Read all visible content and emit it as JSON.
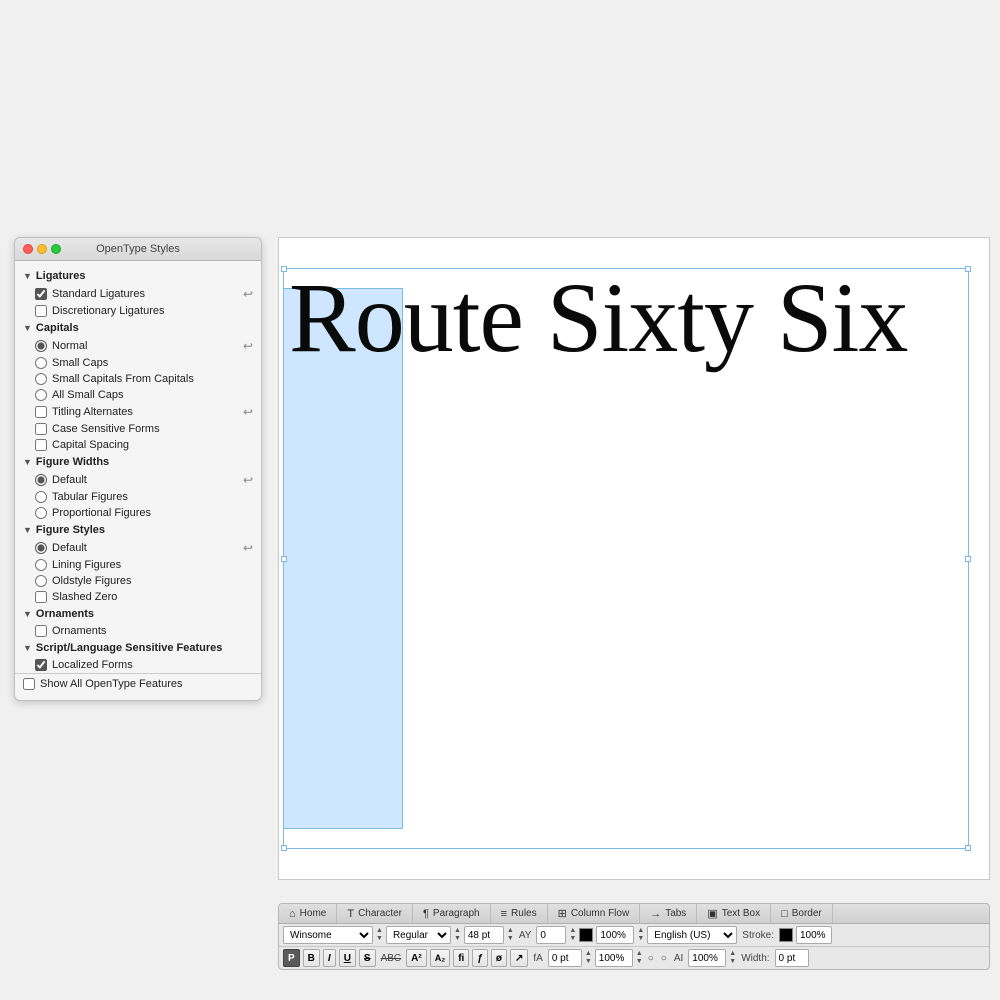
{
  "panel": {
    "title": "OpenType Styles",
    "sections": {
      "ligatures": {
        "label": "Ligatures",
        "items": [
          {
            "id": "standard-ligatures",
            "type": "checkbox",
            "label": "Standard Ligatures",
            "checked": true,
            "icon": true
          },
          {
            "id": "discretionary-ligatures",
            "type": "checkbox",
            "label": "Discretionary Ligatures",
            "checked": false,
            "icon": false
          }
        ]
      },
      "capitals": {
        "label": "Capitals",
        "items": [
          {
            "id": "normal",
            "type": "radio",
            "label": "Normal",
            "checked": true,
            "icon": true
          },
          {
            "id": "small-caps",
            "type": "radio",
            "label": "Small Caps",
            "checked": false,
            "icon": false
          },
          {
            "id": "small-capitals-from-capitals",
            "type": "radio",
            "label": "Small Capitals From Capitals",
            "checked": false,
            "icon": false
          },
          {
            "id": "all-small-caps",
            "type": "radio",
            "label": "All Small Caps",
            "checked": false,
            "icon": false
          },
          {
            "id": "titling-alternates",
            "type": "checkbox",
            "label": "Titling Alternates",
            "checked": false,
            "icon": true
          },
          {
            "id": "case-sensitive-forms",
            "type": "checkbox",
            "label": "Case Sensitive Forms",
            "checked": false,
            "icon": false
          },
          {
            "id": "capital-spacing",
            "type": "checkbox",
            "label": "Capital Spacing",
            "checked": false,
            "icon": false
          }
        ]
      },
      "figureWidths": {
        "label": "Figure Widths",
        "items": [
          {
            "id": "fw-default",
            "type": "radio",
            "label": "Default",
            "checked": true,
            "icon": true
          },
          {
            "id": "tabular-figures",
            "type": "radio",
            "label": "Tabular Figures",
            "checked": false,
            "icon": false
          },
          {
            "id": "proportional-figures",
            "type": "radio",
            "label": "Proportional Figures",
            "checked": false,
            "icon": false
          }
        ]
      },
      "figureStyles": {
        "label": "Figure Styles",
        "items": [
          {
            "id": "fs-default",
            "type": "radio",
            "label": "Default",
            "checked": true,
            "icon": true
          },
          {
            "id": "lining-figures",
            "type": "radio",
            "label": "Lining Figures",
            "checked": false,
            "icon": false
          },
          {
            "id": "oldstyle-figures",
            "type": "radio",
            "label": "Oldstyle Figures",
            "checked": false,
            "icon": false
          },
          {
            "id": "slashed-zero",
            "type": "checkbox",
            "label": "Slashed Zero",
            "checked": false,
            "icon": false
          }
        ]
      },
      "ornaments": {
        "label": "Ornaments",
        "items": [
          {
            "id": "ornaments",
            "type": "checkbox",
            "label": "Ornaments",
            "checked": false,
            "icon": false
          }
        ]
      },
      "scriptLanguage": {
        "label": "Script/Language Sensitive Features",
        "items": [
          {
            "id": "localized-forms",
            "type": "checkbox",
            "label": "Localized Forms",
            "checked": true,
            "icon": false
          }
        ]
      }
    },
    "showAll": {
      "label": "Show All OpenType Features",
      "checked": false
    }
  },
  "canvas": {
    "text": "Route Sixty Six"
  },
  "toolbar": {
    "tabs": [
      {
        "id": "home",
        "label": "Home",
        "icon": "⌂"
      },
      {
        "id": "character",
        "label": "Character",
        "icon": "T"
      },
      {
        "id": "paragraph",
        "label": "Paragraph",
        "icon": "¶"
      },
      {
        "id": "rules",
        "label": "Rules",
        "icon": "≡"
      },
      {
        "id": "column-flow",
        "label": "Column Flow",
        "icon": "⊞"
      },
      {
        "id": "tabs",
        "label": "Tabs",
        "icon": "→"
      },
      {
        "id": "text-box",
        "label": "Text Box",
        "icon": "▣"
      },
      {
        "id": "border",
        "label": "Border",
        "icon": "□"
      }
    ],
    "row1": {
      "font": "Winsome",
      "style": "Regular",
      "size": "48 pt",
      "tracking": "0",
      "color": "#000000",
      "opacity": "100%",
      "language": "English (US)",
      "stroke_label": "Stroke:",
      "stroke_pct": "100%"
    },
    "row2": {
      "buttons": [
        "P",
        "B",
        "I",
        "U",
        "S"
      ],
      "abc_upper": "ABC",
      "a2_super": "A²",
      "a2_sub": "A₂",
      "fi": "fi",
      "frac": "ƒ",
      "ligature": "ø",
      "link": "↗",
      "fA": "fA",
      "baseline": "0 pt",
      "pct2": "100%",
      "circle1": "○",
      "circle2": "○",
      "AI": "AI",
      "ai_pct": "100%",
      "width_label": "Width:",
      "width_val": "0 pt"
    }
  }
}
